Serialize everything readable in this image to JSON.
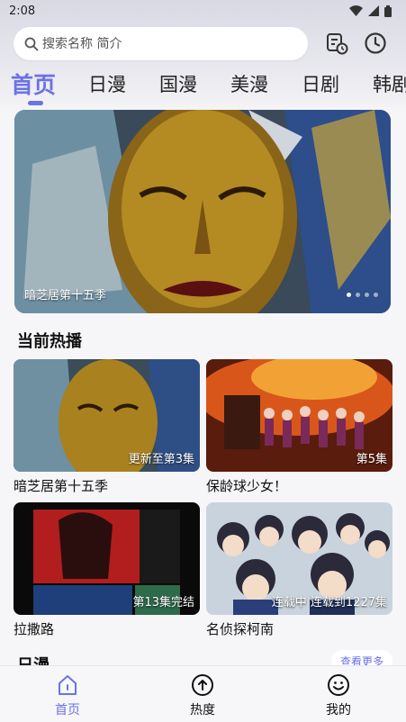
{
  "status": {
    "time": "2:08"
  },
  "search": {
    "placeholder": "搜索名称 简介"
  },
  "tabs": [
    {
      "label": "首页",
      "active": true
    },
    {
      "label": "日漫"
    },
    {
      "label": "国漫"
    },
    {
      "label": "美漫"
    },
    {
      "label": "日剧"
    },
    {
      "label": "韩剧"
    }
  ],
  "banner": {
    "caption": "暗芝居第十五季",
    "page": 1,
    "pages": 4
  },
  "sections": {
    "hot_title": "当前热播",
    "next_title": "日漫",
    "more_label": "查看更多"
  },
  "cards": [
    {
      "title": "暗芝居第十五季",
      "badge": "更新至第3集"
    },
    {
      "title": "保龄球少女！",
      "badge": "第5集"
    },
    {
      "title": "拉撒路",
      "badge": "第13集完结"
    },
    {
      "title": "名侦探柯南",
      "badge": "连载中 连载到1227集"
    }
  ],
  "nav": [
    {
      "label": "首页",
      "icon": "home-icon",
      "active": true
    },
    {
      "label": "热度",
      "icon": "upload-circle-icon"
    },
    {
      "label": "我的",
      "icon": "smiley-icon"
    }
  ],
  "colors": {
    "accent": "#6b72e6",
    "background": "#f6f6f8"
  }
}
